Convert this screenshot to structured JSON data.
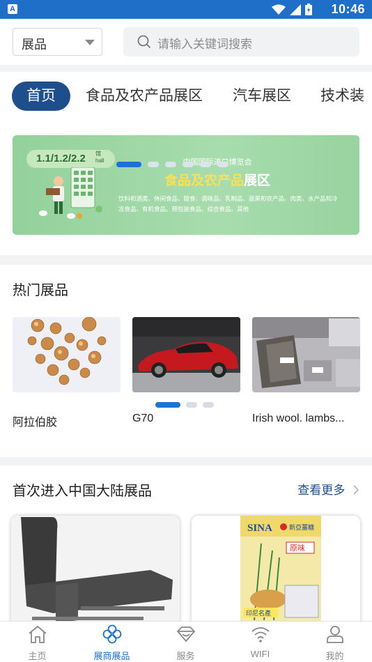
{
  "status_bar": {
    "time": "10:46",
    "app_letter": "A"
  },
  "header": {
    "select_value": "展品",
    "search_placeholder": "请输入关键词搜索"
  },
  "tabs": [
    {
      "label": "首页",
      "active": true
    },
    {
      "label": "食品及农产品展区",
      "active": false
    },
    {
      "label": "汽车展区",
      "active": false
    },
    {
      "label": "技术装",
      "active": false
    }
  ],
  "banner": {
    "hall": "1.1/1.2/2.2",
    "hall_cn": "馆",
    "hall_en": "hall",
    "org": "中国国际进口博览会",
    "title_highlight": "食品及农产品",
    "title_rest": "展区",
    "desc": "饮料和酒类、休闲食品、甜食、调味品、乳制品、蔬果和农产品、肉类、水产品和冷冻食品、有机食品、预包装食品、综合食品、其他",
    "slide_count": 6,
    "active_slide": 0
  },
  "hot": {
    "title": "热门展品",
    "items": [
      {
        "name": "阿拉伯胶"
      },
      {
        "name": "G70"
      },
      {
        "name": "Irish wool. lambs..."
      }
    ],
    "page_count": 3,
    "active_page": 0
  },
  "first_entry": {
    "title": "首次进入中国大陆展品",
    "more": "查看更多",
    "product_brand": "SINA",
    "product_brand_cn": "新亞薑糖",
    "product_flavor": "原味",
    "product_made": "印尼名產"
  },
  "bottom_nav": [
    {
      "label": "主页",
      "icon": "home-icon",
      "active": false
    },
    {
      "label": "展商展品",
      "icon": "clover-icon",
      "active": true
    },
    {
      "label": "服务",
      "icon": "service-icon",
      "active": false
    },
    {
      "label": "WIFI",
      "icon": "wifi-icon",
      "active": false
    },
    {
      "label": "我的",
      "icon": "user-icon",
      "active": false
    }
  ],
  "colors": {
    "status_bar": "#1f6fc8",
    "accent": "#1e4e8c",
    "active_nav": "#1e6fc8",
    "banner": "#9fd8a6"
  }
}
